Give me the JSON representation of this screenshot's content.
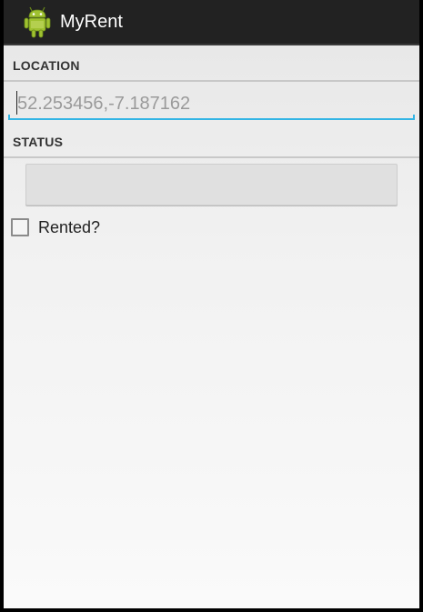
{
  "app": {
    "title": "MyRent",
    "icon": "android-icon"
  },
  "location": {
    "header": "LOCATION",
    "hint": "52.253456,-7.187162",
    "value": ""
  },
  "status": {
    "header": "STATUS",
    "button_label": ""
  },
  "rented": {
    "label": "Rented?",
    "checked": false
  },
  "colors": {
    "action_bar": "#222222",
    "accent": "#33b5e5",
    "background": "#f1f1f1"
  }
}
